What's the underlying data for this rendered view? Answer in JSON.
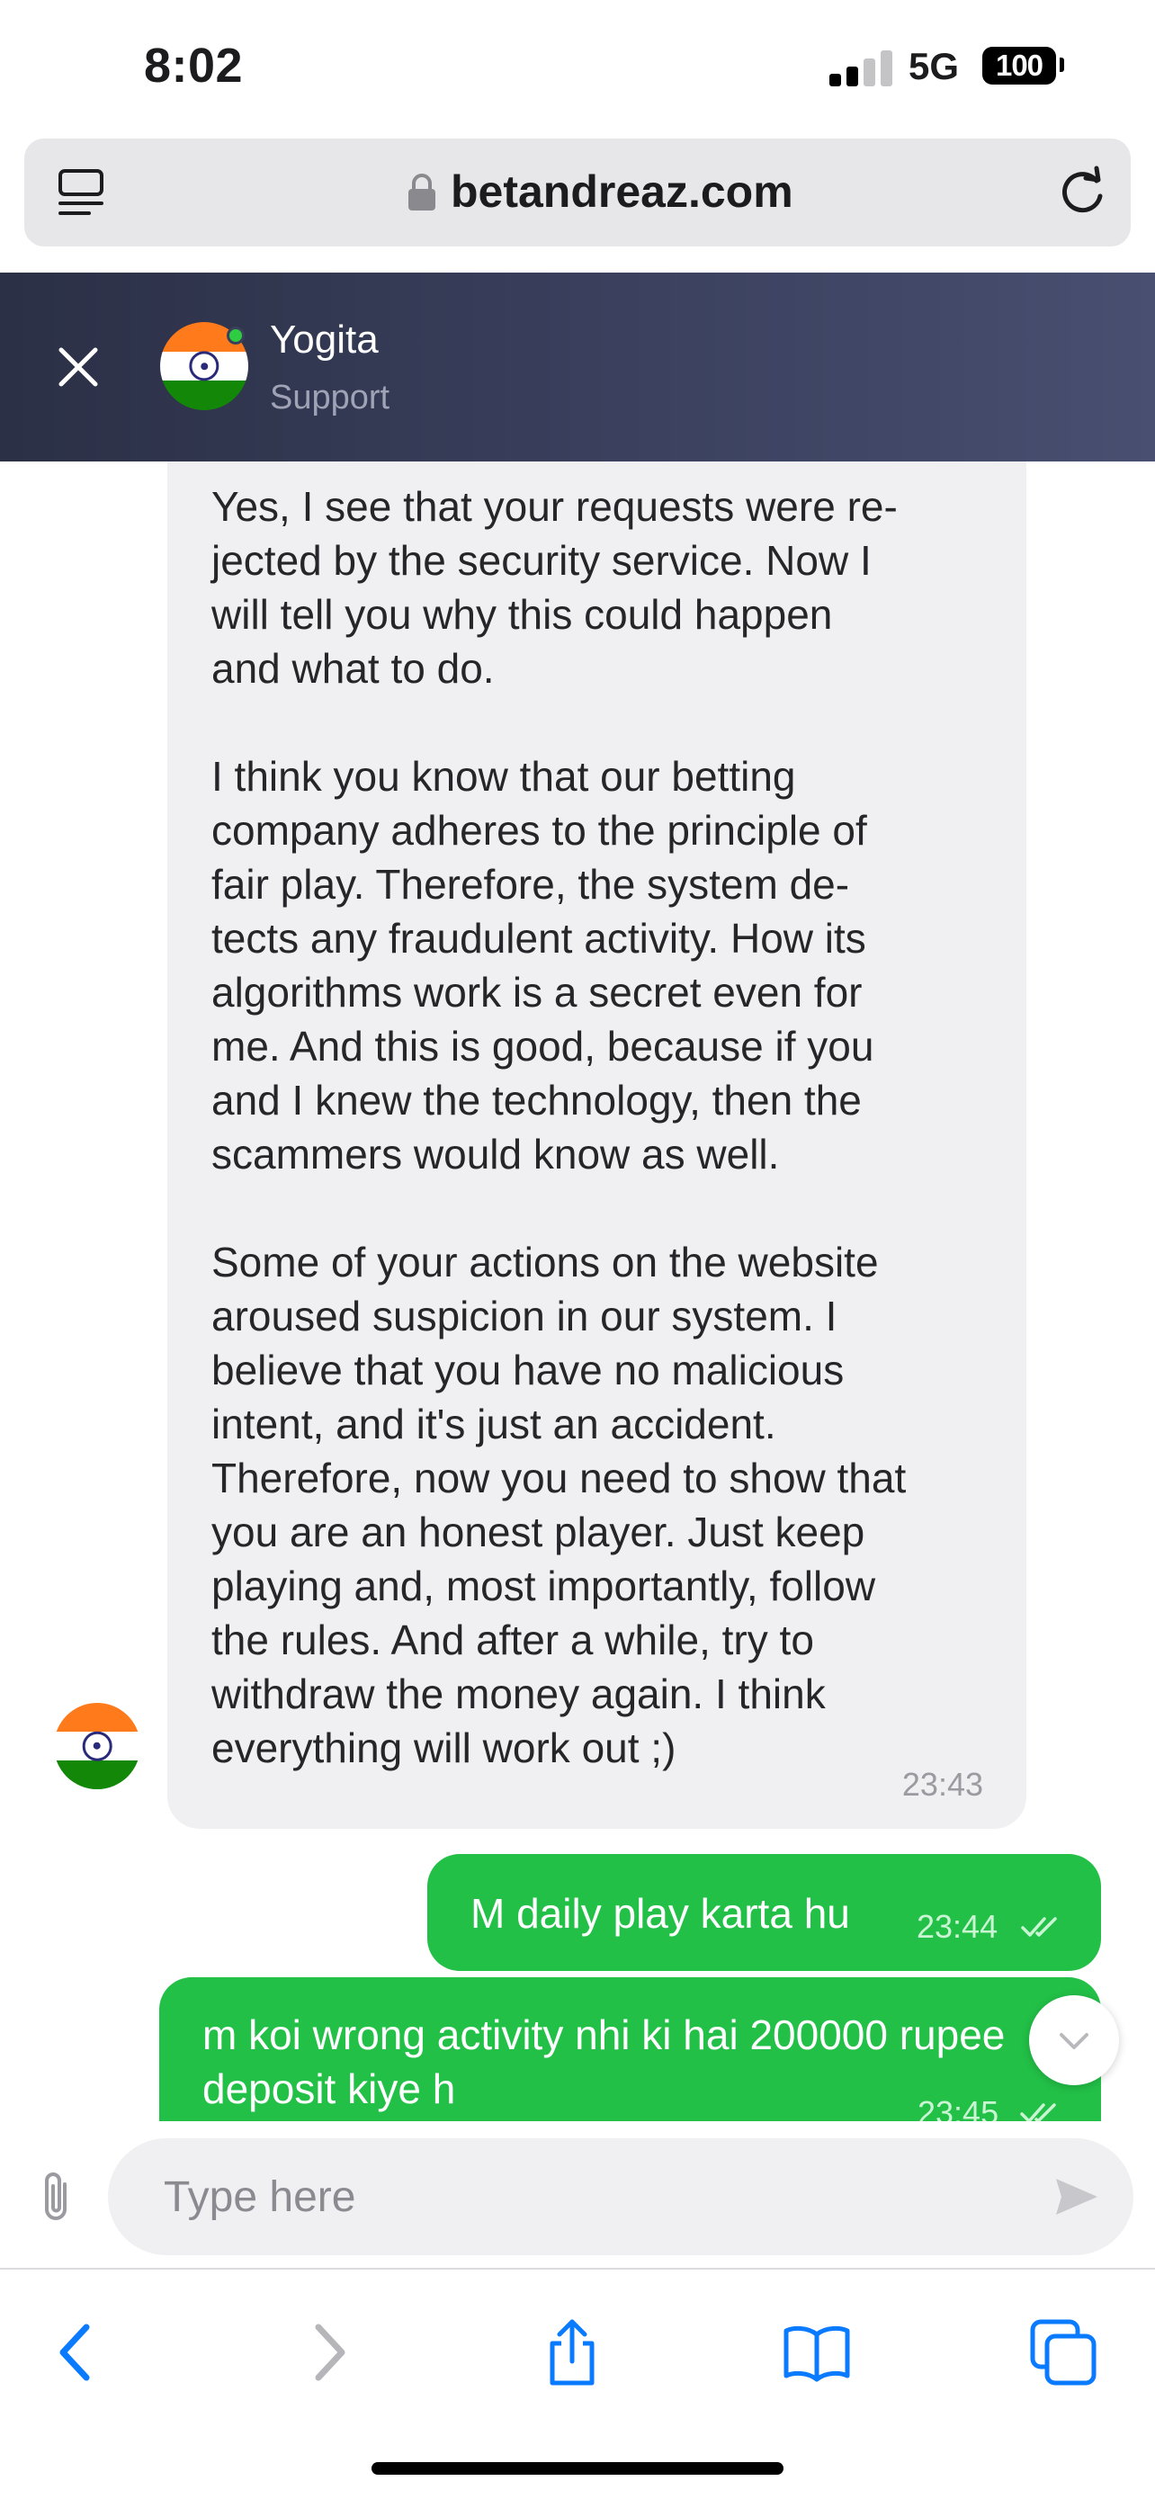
{
  "status_bar": {
    "time": "8:02",
    "network": "5G",
    "battery": "100"
  },
  "browser": {
    "url": "betandreaz.com",
    "icons": [
      "tab-overview-icon",
      "lock-icon",
      "reload-icon"
    ]
  },
  "chat_header": {
    "agent_name": "Yogita",
    "agent_role": "Support",
    "status_color": "#2ecc40"
  },
  "messages": [
    {
      "direction": "incoming",
      "text": "Yes, I see that your requests were re-\njected by the security service. Now I\nwill tell you why this could happen\nand what to do.\n\nI think you know that our betting\ncompany adheres to the principle of\nfair play. Therefore, the system de-\ntects any fraudulent activity. How its\nalgorithms work is a secret even for\nme. And this is good, because if you\nand I knew the technology, then the\nscammers would know as well.\n\nSome of your actions on the website\naroused suspicion in our system. I\nbelieve that you have no malicious\nintent, and it's just an accident.\nTherefore, now you need to show that\nyou are an honest player. Just keep\nplaying and, most importantly, follow\nthe rules. And after a while, try to\nwithdraw the money again. I think\neverything will work out ;)",
      "time": "23:43"
    },
    {
      "direction": "outgoing",
      "text": "M daily play karta hu",
      "time": "23:44"
    },
    {
      "direction": "outgoing",
      "text": "m koi wrong activity nhi ki hai 200000 rupee deposit kiye h",
      "time": "23:45"
    }
  ],
  "composer": {
    "placeholder": "Type here"
  },
  "colors": {
    "header_start": "#2b3046",
    "header_end": "#484f70",
    "outgoing_bubble": "#22c047",
    "incoming_bubble": "#f0f0f2",
    "ios_blue": "#0a7aff",
    "saffron": "#ff7a1a",
    "green": "#138808"
  }
}
